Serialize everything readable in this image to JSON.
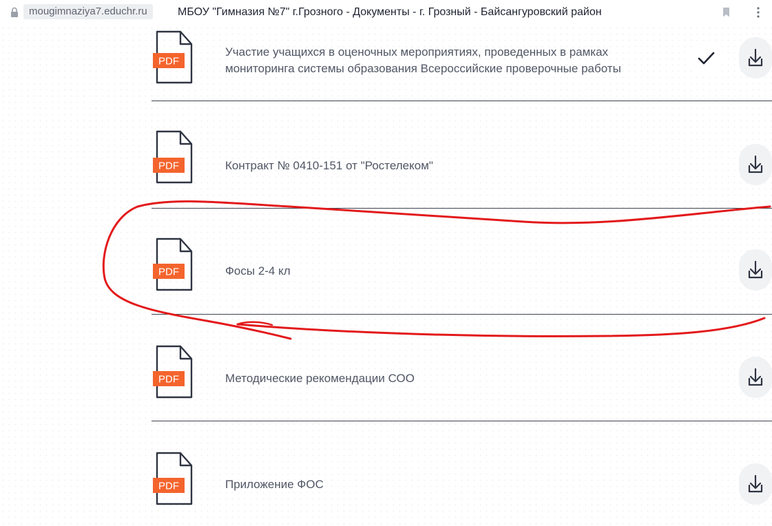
{
  "browser": {
    "url": "mougimnaziya7.educhr.ru",
    "page_title": "МБОУ \"Гимназия №7\" г.Грозного - Документы - г. Грозный - Байсангуровский район"
  },
  "documents": [
    {
      "title_line1": "Участие учащихся в оценочных мероприятиях, проведенных в рамках",
      "title_line2": "мониторинга системы образования Всероссийские проверочные работы",
      "file_type": "PDF",
      "viewed": true
    },
    {
      "title_line1": "Контракт № 0410-151 от \"Ростелеком\"",
      "file_type": "PDF",
      "viewed": false
    },
    {
      "title_line1": "Фосы 2-4 кл",
      "file_type": "PDF",
      "viewed": false
    },
    {
      "title_line1": "Методические рекомендации СОО",
      "file_type": "PDF",
      "viewed": false
    },
    {
      "title_line1": "Приложение ФОС",
      "file_type": "PDF",
      "viewed": false
    }
  ],
  "icons": {
    "file": "pdf-file-icon",
    "download": "download-icon",
    "check": "check-icon",
    "lock": "lock-icon",
    "bookmark": "bookmark-icon",
    "menu": "more-vertical-icon"
  },
  "colors": {
    "pdf_badge": "#f4642d",
    "icon_stroke": "#2f3442",
    "annotation": "#e3191b",
    "divider": "#3e4350"
  }
}
